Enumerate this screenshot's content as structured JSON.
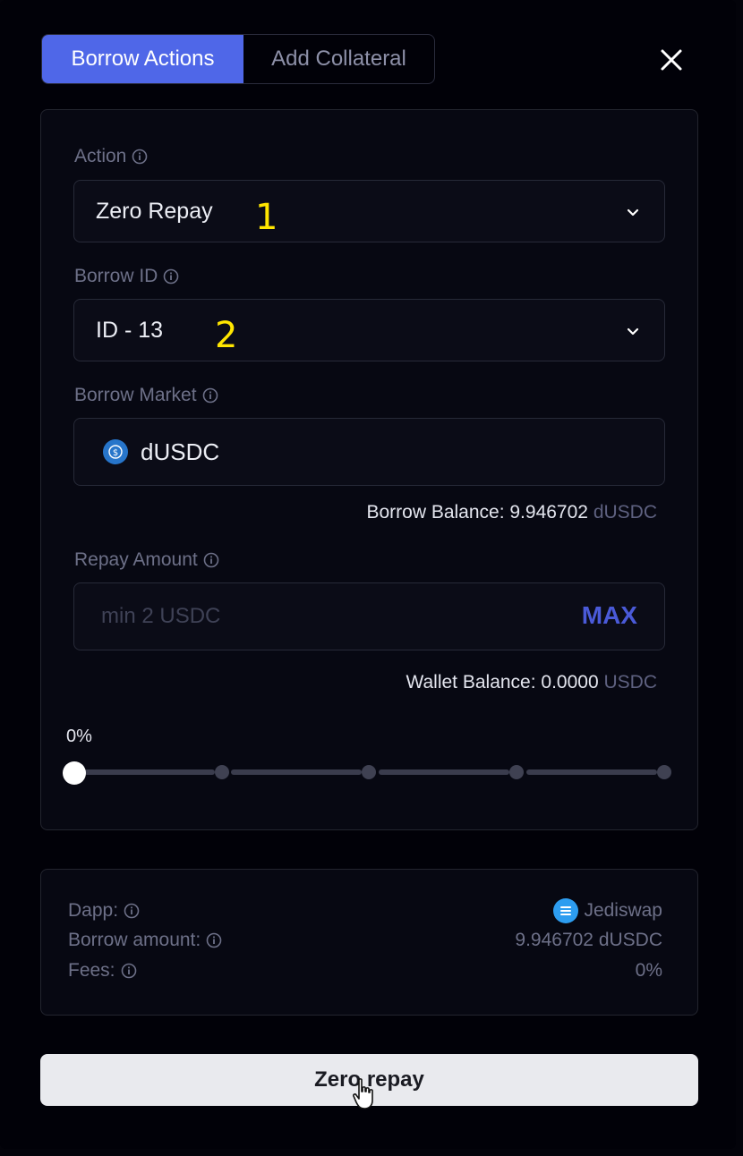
{
  "tabs": [
    {
      "label": "Borrow Actions",
      "active": true
    },
    {
      "label": "Add Collateral",
      "active": false
    }
  ],
  "colors": {
    "accent": "#4f67e8",
    "max": "#4a5ad8",
    "annotation": "#ffe600"
  },
  "action": {
    "label": "Action",
    "value": "Zero Repay",
    "annotation": "1"
  },
  "borrow_id": {
    "label": "Borrow ID",
    "value": "ID - 13",
    "annotation": "2"
  },
  "market": {
    "label": "Borrow Market",
    "value": "dUSDC",
    "icon": "usdc-coin-icon",
    "balance_label": "Borrow Balance: 9.946702",
    "balance_unit": "dUSDC"
  },
  "repay": {
    "label": "Repay Amount",
    "placeholder": "min 2 USDC",
    "max_label": "MAX",
    "wallet_label": "Wallet Balance: 0.0000",
    "wallet_unit": "USDC"
  },
  "slider": {
    "value_label": "0%",
    "value": 0,
    "steps": [
      0,
      25,
      50,
      75,
      100
    ]
  },
  "summary": {
    "dapp_label": "Dapp:",
    "dapp_value": "Jediswap",
    "borrow_amount_label": "Borrow amount:",
    "borrow_amount_value": "9.946702 dUSDC",
    "fees_label": "Fees:",
    "fees_value": "0%"
  },
  "submit_label": "Zero repay"
}
